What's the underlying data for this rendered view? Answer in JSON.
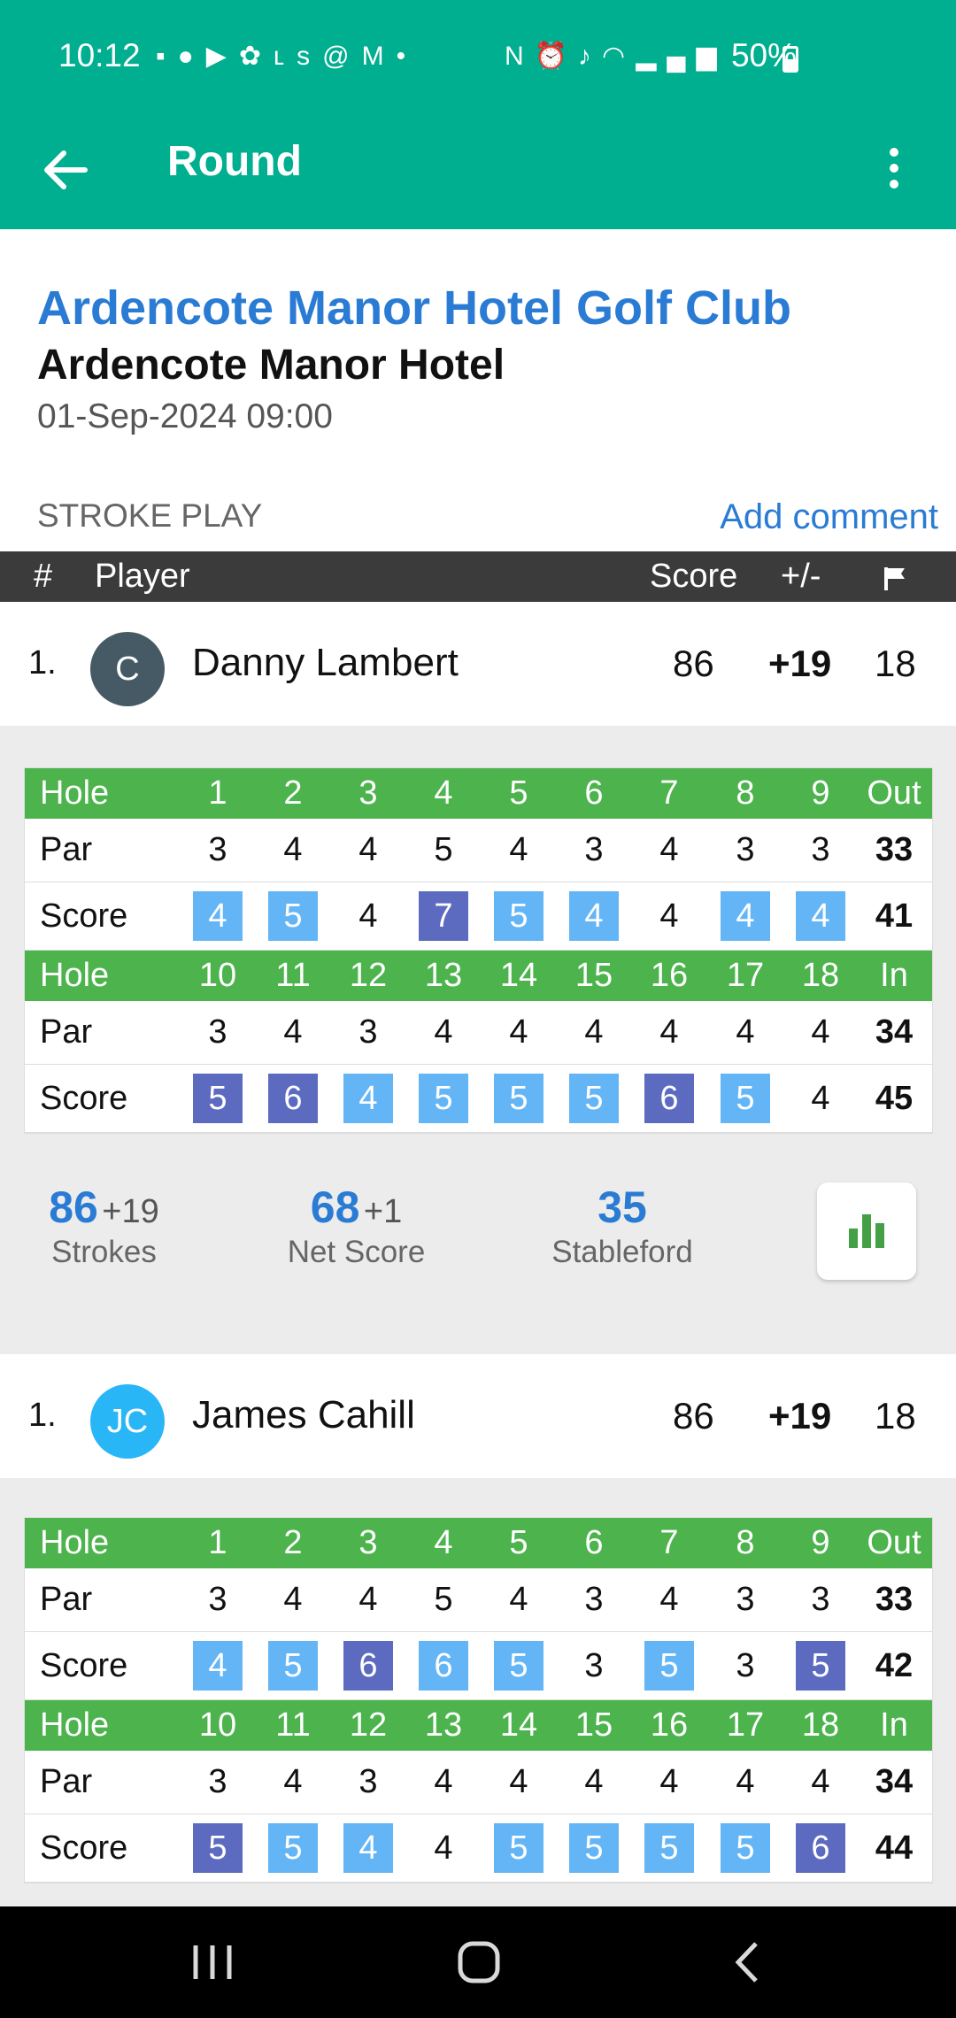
{
  "status_bar": {
    "time": "10:12",
    "left_icons": [
      "temu-icon",
      "facebook-icon",
      "youtube-icon",
      "app-icon",
      "ls-icon",
      "threads-icon",
      "gmail-icon",
      "dot-icon"
    ],
    "right_icons": [
      "nfc-icon",
      "alarm-icon",
      "mute-icon",
      "wifi-icon",
      "signal-icon"
    ],
    "battery": "50%"
  },
  "app_bar": {
    "title": "Round"
  },
  "round": {
    "club": "Ardencote Manor Hotel Golf Club",
    "course": "Ardencote Manor Hotel",
    "datetime": "01-Sep-2024 09:00",
    "format": "STROKE PLAY",
    "add_comment": "Add comment"
  },
  "table_header": {
    "rank": "#",
    "player": "Player",
    "score": "Score",
    "diff": "+/-"
  },
  "scorecard_labels": {
    "hole": "Hole",
    "par": "Par",
    "score": "Score",
    "out": "Out",
    "in": "In"
  },
  "colors": {
    "primary": "#00ae90",
    "link": "#2a7bd4",
    "hole_row": "#4cb34d",
    "bogey": "#64b5f6",
    "double_bogey": "#5c6bc0"
  },
  "players": [
    {
      "rank": "1.",
      "initials": "C",
      "avatar_color": "#455a64",
      "name": "Danny Lambert",
      "score": "86",
      "diff": "+19",
      "thru": "18",
      "front": {
        "holes": [
          "1",
          "2",
          "3",
          "4",
          "5",
          "6",
          "7",
          "8",
          "9"
        ],
        "par": [
          "3",
          "4",
          "4",
          "5",
          "4",
          "3",
          "4",
          "3",
          "3"
        ],
        "scores": [
          "4",
          "5",
          "4",
          "7",
          "5",
          "4",
          "4",
          "4",
          "4"
        ],
        "par_total": "33",
        "score_total": "41"
      },
      "back": {
        "holes": [
          "10",
          "11",
          "12",
          "13",
          "14",
          "15",
          "16",
          "17",
          "18"
        ],
        "par": [
          "3",
          "4",
          "3",
          "4",
          "4",
          "4",
          "4",
          "4",
          "4"
        ],
        "scores": [
          "5",
          "6",
          "4",
          "5",
          "5",
          "5",
          "6",
          "5",
          "4"
        ],
        "par_total": "34",
        "score_total": "45"
      },
      "stats": {
        "strokes": "86",
        "strokes_diff": "+19",
        "strokes_label": "Strokes",
        "net": "68",
        "net_diff": "+1",
        "net_label": "Net Score",
        "stableford": "35",
        "stableford_label": "Stableford"
      }
    },
    {
      "rank": "1.",
      "initials": "JC",
      "avatar_color": "#29b6f6",
      "name": "James Cahill",
      "score": "86",
      "diff": "+19",
      "thru": "18",
      "front": {
        "holes": [
          "1",
          "2",
          "3",
          "4",
          "5",
          "6",
          "7",
          "8",
          "9"
        ],
        "par": [
          "3",
          "4",
          "4",
          "5",
          "4",
          "3",
          "4",
          "3",
          "3"
        ],
        "scores": [
          "4",
          "5",
          "6",
          "6",
          "5",
          "3",
          "5",
          "3",
          "5"
        ],
        "par_total": "33",
        "score_total": "42"
      },
      "back": {
        "holes": [
          "10",
          "11",
          "12",
          "13",
          "14",
          "15",
          "16",
          "17",
          "18"
        ],
        "par": [
          "3",
          "4",
          "3",
          "4",
          "4",
          "4",
          "4",
          "4",
          "4"
        ],
        "scores": [
          "5",
          "5",
          "4",
          "4",
          "5",
          "5",
          "5",
          "5",
          "6"
        ],
        "par_total": "34",
        "score_total": "44"
      }
    }
  ]
}
